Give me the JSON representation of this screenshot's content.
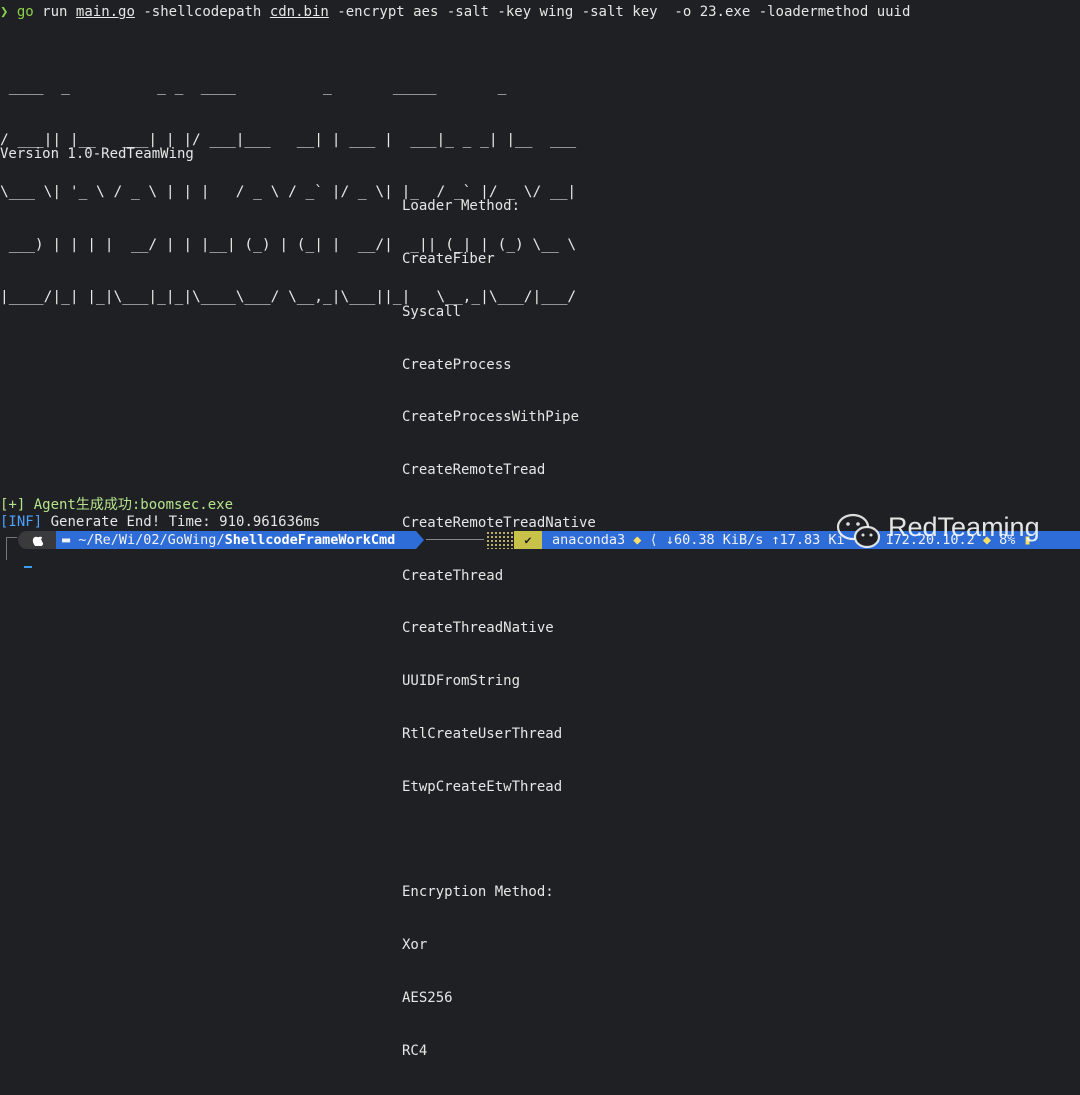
{
  "terminal": {
    "command": {
      "prompt_symbol": "❯",
      "program": "go",
      "verb": "run",
      "file": "main.go",
      "arg1": "-shellcodepath",
      "path": "cdn.bin",
      "rest": "-encrypt aes -salt -key wing -salt key  -o 23.exe -loadermethod uuid"
    },
    "ascii_banner": [
      " ____  _          _ _  ____          _       _____       _         ",
      "/ ___|| |__   ___| | |/ ___|___   __| | ___ |  ___|_ _ _| |__  ___ ",
      "\\___ \\| '_ \\ / _ \\ | | |   / _ \\ / _` |/ _ \\| |_  / _` |/ _ \\/ __|",
      " ___) | | | |  __/ | | |__| (_) | (_| |  __/|  _|| (_| | (_) \\__ \\",
      "|____/|_| |_|\\___|_|_|\\____\\___/ \\__,_|\\___||_|   \\__,_|\\___/|___/"
    ],
    "version": "Version 1.0-RedTeamWing",
    "loader_title": "Loader Method:",
    "loader_methods": [
      "CreateFiber",
      "Syscall",
      "CreateProcess",
      "CreateProcessWithPipe",
      "CreateRemoteTread",
      "CreateRemoteTreadNative",
      "CreateThread",
      "CreateThreadNative",
      "UUIDFromString",
      "RtlCreateUserThread",
      "EtwpCreateEtwThread"
    ],
    "encryption_title": "Encryption Method:",
    "encryption_methods": [
      "Xor",
      "AES256",
      "RC4"
    ],
    "agent_line": "[+] Agent生成成功:boomsec.exe",
    "inf_tag": "[INF]",
    "inf_text": " Generate End! Time: 910.961636ms"
  },
  "prompt": {
    "apple": "",
    "folder_icon": "folder-icon",
    "path_prefix": " ~/Re/Wi/02/GoWing/",
    "path_current": "ShellcodeFrameWorkCmd",
    "check": "✔",
    "env": "anaconda3",
    "net_down": "↓60.38 KiB/s",
    "net_up": "↑17.83 Ki",
    "ip": "172.20.10.2",
    "battery": "8%"
  },
  "watermark": {
    "text": "RedTeaming"
  },
  "colors": {
    "background": "#1f2023",
    "accent_green": "#8bd14a",
    "prompt_blue": "#2e6cd8",
    "info_blue": "#4ea1ff"
  }
}
